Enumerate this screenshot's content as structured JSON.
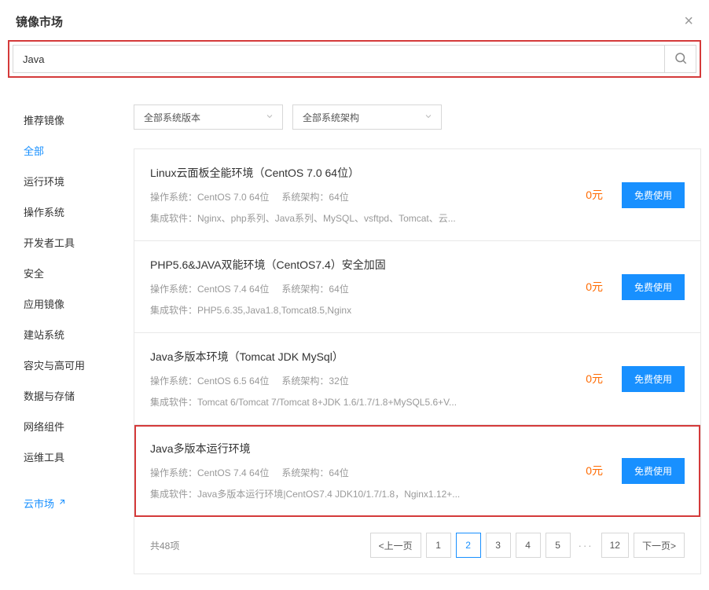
{
  "header": {
    "title": "镜像市场"
  },
  "search": {
    "value": "Java"
  },
  "sidebar": {
    "items": [
      {
        "label": "推荐镜像",
        "active": false
      },
      {
        "label": "全部",
        "active": true
      },
      {
        "label": "运行环境",
        "active": false
      },
      {
        "label": "操作系统",
        "active": false
      },
      {
        "label": "开发者工具",
        "active": false
      },
      {
        "label": "安全",
        "active": false
      },
      {
        "label": "应用镜像",
        "active": false
      },
      {
        "label": "建站系统",
        "active": false
      },
      {
        "label": "容灾与高可用",
        "active": false
      },
      {
        "label": "数据与存储",
        "active": false
      },
      {
        "label": "网络组件",
        "active": false
      },
      {
        "label": "运维工具",
        "active": false
      }
    ],
    "cloud_market": "云市场"
  },
  "filters": {
    "os_version": "全部系统版本",
    "arch": "全部系统架构"
  },
  "labels": {
    "os": "操作系统：",
    "arch": "系统架构：",
    "software": "集成软件：",
    "use_btn": "免费使用"
  },
  "items": [
    {
      "title": "Linux云面板全能环境（CentOS 7.0 64位）",
      "os": "CentOS 7.0 64位",
      "arch": "64位",
      "software": "Nginx、php系列、Java系列、MySQL、vsftpd、Tomcat、云...",
      "price": "0元",
      "highlighted": false
    },
    {
      "title": "PHP5.6&JAVA双能环境（CentOS7.4）安全加固",
      "os": "CentOS 7.4 64位",
      "arch": "64位",
      "software": "PHP5.6.35,Java1.8,Tomcat8.5,Nginx",
      "price": "0元",
      "highlighted": false
    },
    {
      "title": "Java多版本环境（Tomcat JDK MySql）",
      "os": "CentOS 6.5 64位",
      "arch": "32位",
      "software": "Tomcat 6/Tomcat 7/Tomcat 8+JDK 1.6/1.7/1.8+MySQL5.6+V...",
      "price": "0元",
      "highlighted": false
    },
    {
      "title": "Java多版本运行环境",
      "os": "CentOS 7.4 64位",
      "arch": "64位",
      "software": "Java多版本运行环境|CentOS7.4 JDK10/1.7/1.8，Nginx1.12+...",
      "price": "0元",
      "highlighted": true
    }
  ],
  "pagination": {
    "total_text": "共48项",
    "prev": "<上一页",
    "next": "下一页>",
    "pages": [
      "1",
      "2",
      "3",
      "4",
      "5"
    ],
    "ellipsis": "···",
    "last": "12",
    "active": "2"
  }
}
